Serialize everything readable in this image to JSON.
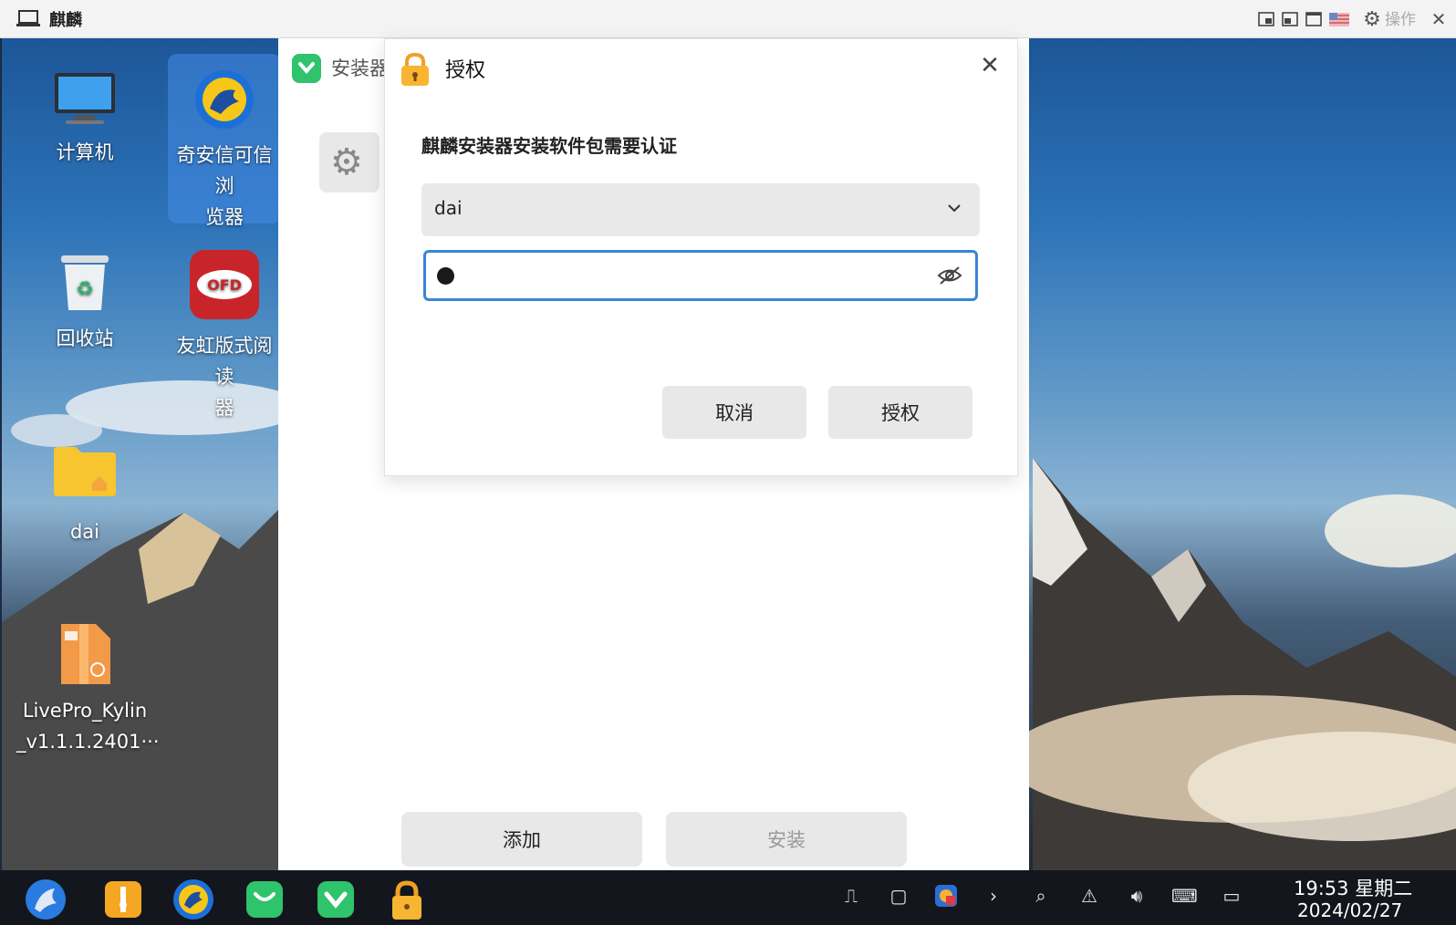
{
  "vm_window": {
    "title": "麒麟",
    "operations_label": "操作"
  },
  "desktop": {
    "icons": [
      {
        "label_line1": "计算机",
        "label_line2": ""
      },
      {
        "label_line1": "奇安信可信浏",
        "label_line2": "览器"
      },
      {
        "label_line1": "回收站",
        "label_line2": ""
      },
      {
        "label_line1": "友虹版式阅读",
        "label_line2": "器"
      },
      {
        "label_line1": "dai",
        "label_line2": ""
      },
      {
        "label_line1": "LivePro_Kylin",
        "label_line2": "_v1.1.1.2401···"
      }
    ]
  },
  "installer": {
    "title": "安装器",
    "add_label": "添加",
    "install_label": "安装"
  },
  "auth_dialog": {
    "title": "授权",
    "message": "麒麟安装器安装软件包需要认证",
    "username": "dai",
    "cancel_label": "取消",
    "authorize_label": "授权"
  },
  "taskbar": {
    "time": "19:53 星期二",
    "date": "2024/02/27"
  },
  "colors": {
    "focus_border": "#3a86d4",
    "taskbar_bg": "#13161c",
    "selected_icon_bg": "#468ce6"
  }
}
